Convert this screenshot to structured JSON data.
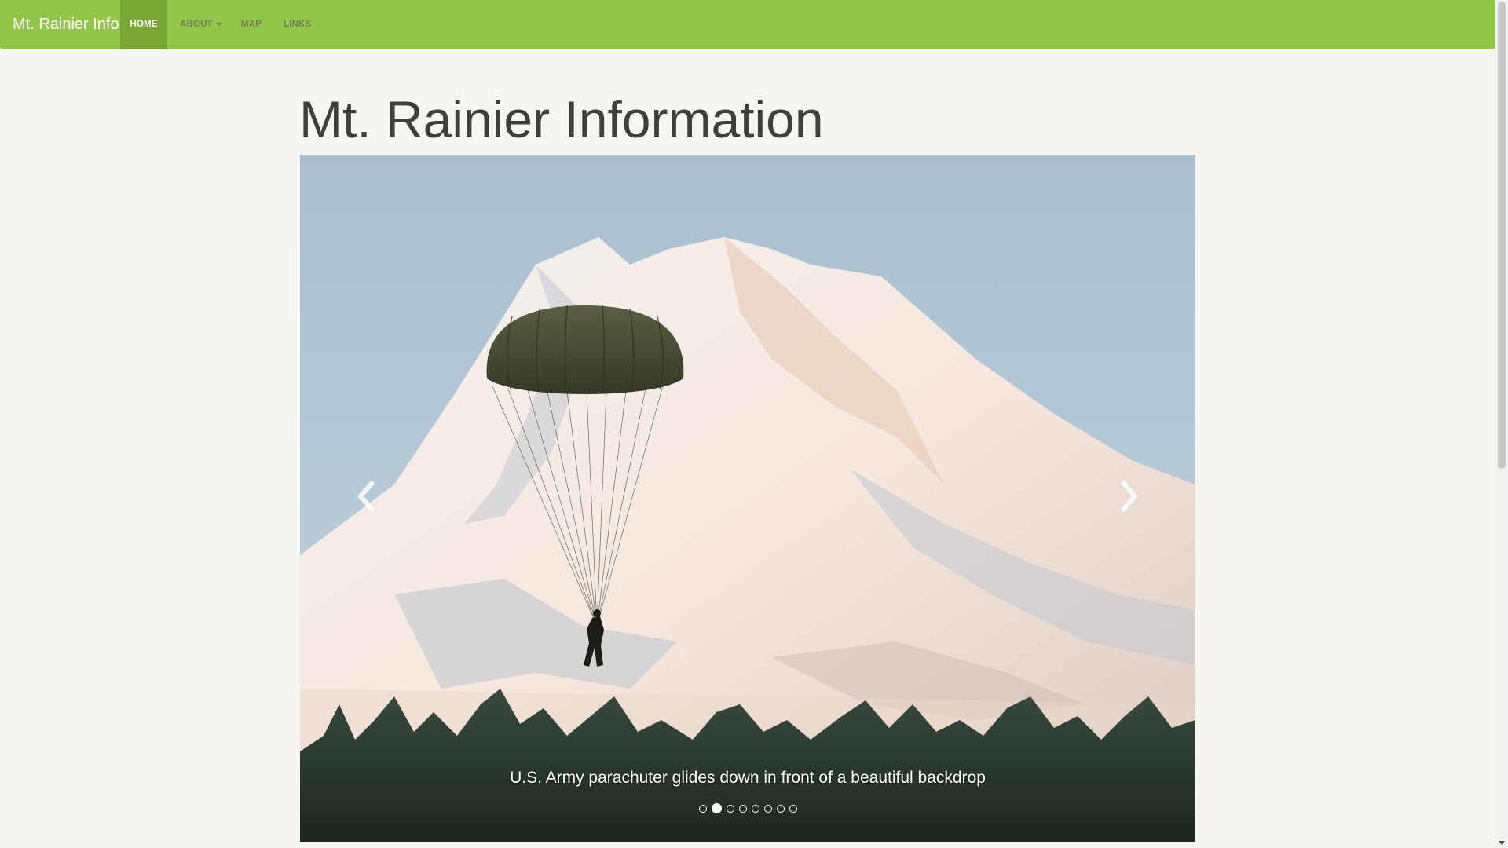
{
  "navbar": {
    "brand": "Mt. Rainier Info",
    "items": [
      {
        "label": "HOME",
        "active": true
      },
      {
        "label": "ABOUT",
        "dropdown": true
      },
      {
        "label": "MAP"
      },
      {
        "label": "LINKS"
      }
    ]
  },
  "page": {
    "title": "Mt. Rainier Information"
  },
  "carousel": {
    "caption": "U.S. Army parachuter glides down in front of a beautiful backdrop",
    "slide_count": 8,
    "active_slide": 2,
    "prev_icon": "chevron-left-icon",
    "next_icon": "chevron-right-icon"
  },
  "colors": {
    "navbar": "#93c54b",
    "navbar_active": "#79a736",
    "background": "#f7f5f1",
    "title": "#3e3f3a"
  }
}
